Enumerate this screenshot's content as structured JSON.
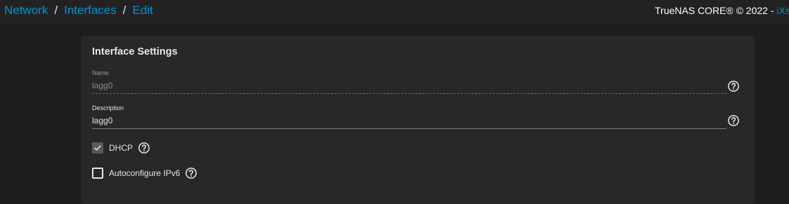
{
  "breadcrumb": {
    "items": [
      "Network",
      "Interfaces",
      "Edit"
    ],
    "separator": "/"
  },
  "copyright": {
    "text": "TrueNAS CORE® © 2022 - ",
    "brand": "iXsy"
  },
  "card": {
    "title": "Interface Settings",
    "name_field": {
      "label": "Name",
      "value": "lagg0"
    },
    "description_field": {
      "label": "Description",
      "value": "lagg0"
    },
    "dhcp": {
      "label": "DHCP",
      "checked": true
    },
    "autoconfig_ipv6": {
      "label": "Autoconfigure IPv6",
      "checked": false
    }
  },
  "icons": {
    "help": "help-circle-icon",
    "check": "check-icon"
  },
  "colors": {
    "accent": "#0095d5",
    "background": "#1e1e1e",
    "topbar": "#222222",
    "card": "#282828",
    "text": "#e6e6e6"
  }
}
